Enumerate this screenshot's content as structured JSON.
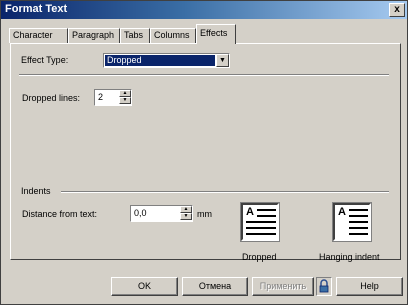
{
  "window": {
    "title": "Format Text",
    "close": "x"
  },
  "tabs": [
    "Character",
    "Paragraph",
    "Tabs",
    "Columns",
    "Effects"
  ],
  "effects": {
    "effect_type_label": "Effect Type:",
    "effect_type_value": "Dropped",
    "dropped_lines_label": "Dropped lines:",
    "dropped_lines_value": "2",
    "indents_label": "Indents",
    "distance_label": "Distance from text:",
    "distance_value": "0,0",
    "distance_unit": "mm",
    "preview_dropped": "Dropped",
    "preview_hanging": "Hanging indent",
    "preview_letter": "A"
  },
  "buttons": {
    "ok": "OK",
    "cancel": "Отмена",
    "apply": "Применить",
    "help": "Help"
  },
  "icons": {
    "spin_up": "up-arrow",
    "spin_down": "down-arrow",
    "combo_arrow": "down-arrow",
    "lock": "lock"
  }
}
